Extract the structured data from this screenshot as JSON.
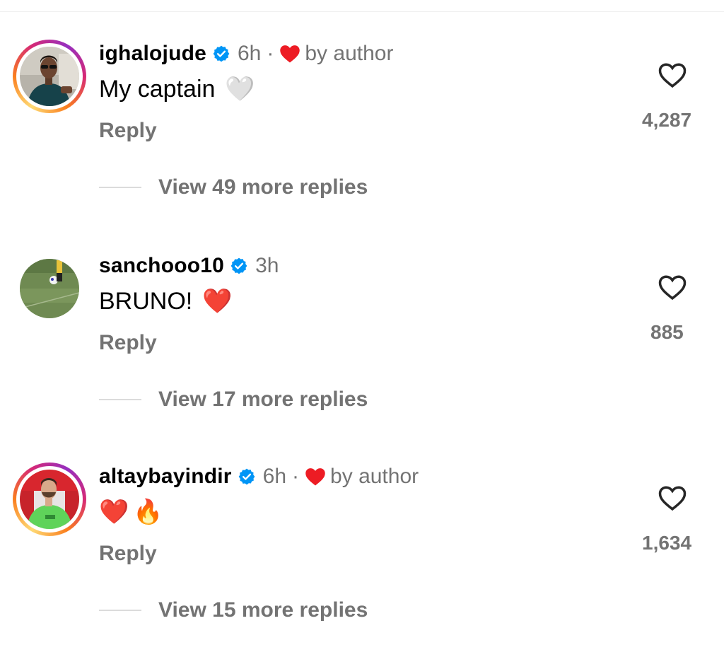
{
  "colors": {
    "verified": "#0095f6",
    "secondary_text": "#737373",
    "author_heart": "#ed1c24"
  },
  "comments": [
    {
      "username": "ighalojude",
      "time": "6h",
      "separator": "·",
      "liked_by_author": "by author",
      "text": "My captain",
      "emoji": "🤍",
      "reply": "Reply",
      "like_count": "4,287",
      "view_more": "View 49 more replies",
      "avatar_icon": "person-sunglasses-avatar"
    },
    {
      "username": "sanchooo10",
      "time": "3h",
      "text": "BRUNO!",
      "emoji": "❤️",
      "reply": "Reply",
      "like_count": "885",
      "view_more": "View 17 more replies",
      "avatar_icon": "football-pitch-avatar"
    },
    {
      "username": "altaybayindir",
      "time": "6h",
      "separator": "·",
      "liked_by_author": "by author",
      "text": "",
      "emoji_1": "❤️",
      "emoji_2": "🔥",
      "reply": "Reply",
      "like_count": "1,634",
      "view_more": "View 15 more replies",
      "avatar_icon": "goalkeeper-green-kit-avatar"
    }
  ]
}
